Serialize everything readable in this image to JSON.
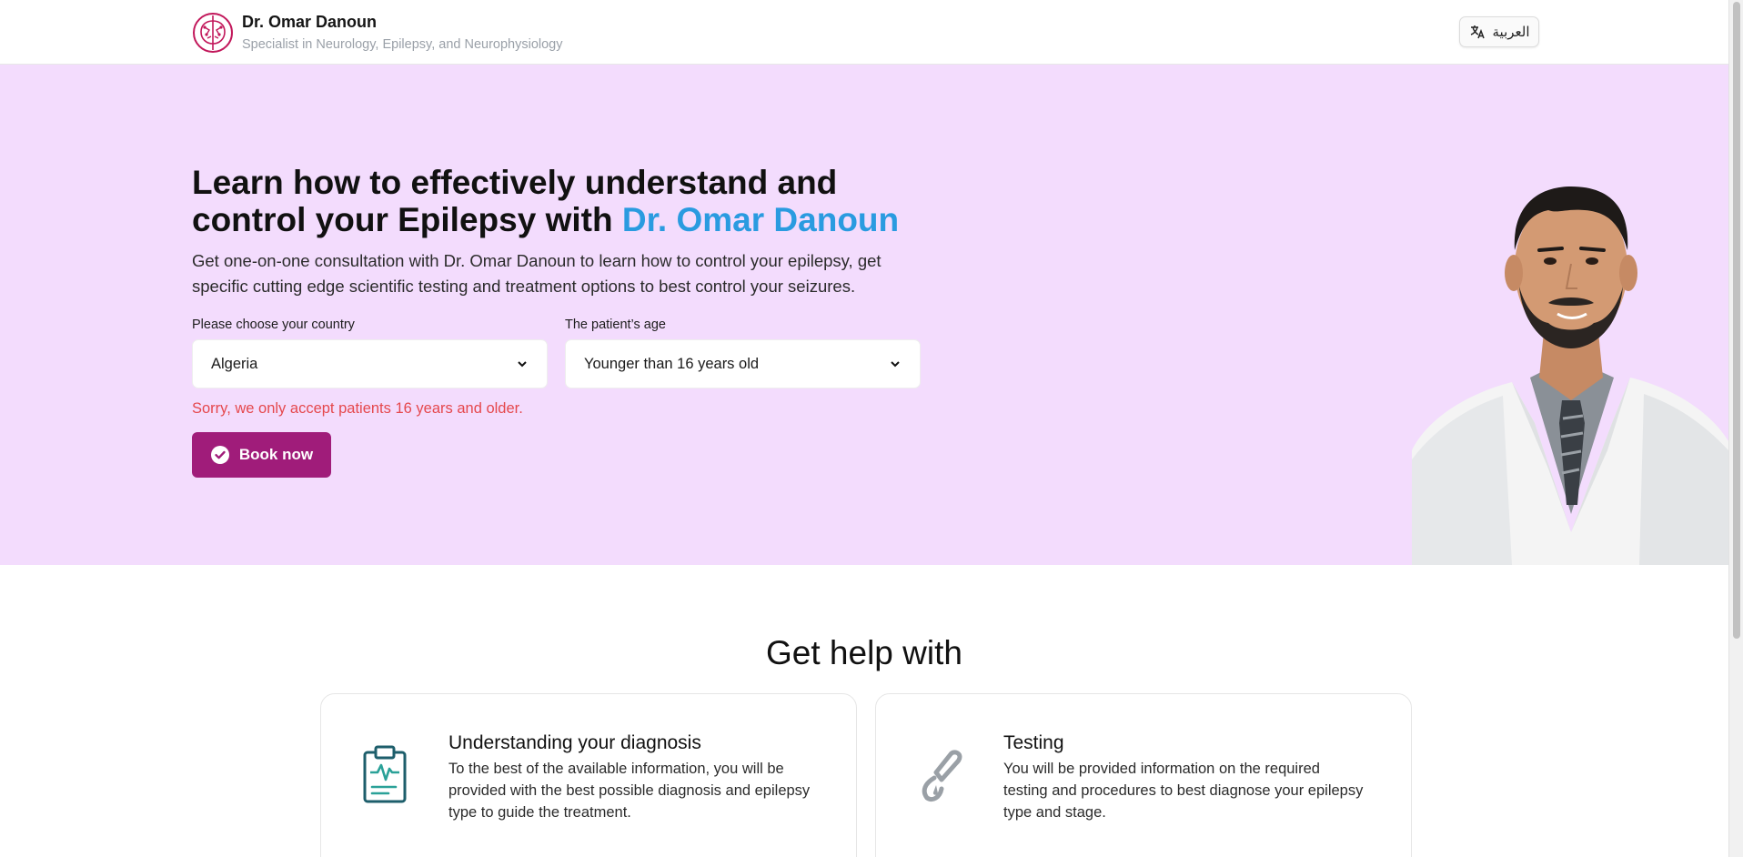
{
  "header": {
    "brand_name": "Dr. Omar Danoun",
    "brand_subtitle": "Specialist in Neurology, Epilepsy, and Neurophysiology",
    "language_button": "العربية"
  },
  "hero": {
    "title_part1": "Learn how to effectively understand and control your Epilepsy with ",
    "title_accent": "Dr. Omar Danoun",
    "description": "Get one-on-one consultation with Dr. Omar Danoun to learn how to control your epilepsy, get specific cutting edge scientific testing and treatment options to best control your seizures.",
    "country_label": "Please choose your country",
    "country_value": "Algeria",
    "age_label": "The patient’s age",
    "age_value": "Younger than 16 years old",
    "error_message": "Sorry, we only accept patients 16 years and older.",
    "book_button": "Book now"
  },
  "help": {
    "title": "Get help with",
    "cards": [
      {
        "icon": "clipboard-pulse-icon",
        "title": "Understanding your diagnosis",
        "text": "To the best of the available information, you will be provided with the best possible diagnosis and epilepsy type to guide the treatment."
      },
      {
        "icon": "test-dropper-icon",
        "title": "Testing",
        "text": "You will be provided information on the required testing and procedures to best diagnose your epilepsy type and stage."
      }
    ]
  },
  "colors": {
    "hero_background": "#f3dcfd",
    "accent_blue": "#2a9be0",
    "button_magenta": "#a01c7a",
    "error_red": "#e5484d",
    "logo_pink": "#c2185b"
  }
}
